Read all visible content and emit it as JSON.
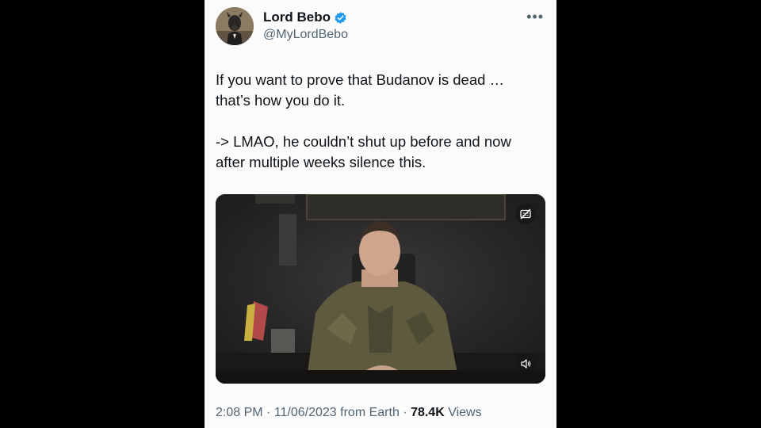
{
  "tweet": {
    "display_name": "Lord Bebo",
    "handle": "@MyLordBebo",
    "more_label": "•••",
    "paragraphs": [
      "If you want to prove that Budanov is dead …\nthat’s how you do it.",
      "-> LMAO, he couldn’t shut up before and now\nafter multiple weeks silence this."
    ],
    "time": "2:08 PM",
    "sep1": " · ",
    "date": "11/06/2023",
    "source": " from Earth",
    "sep2": " · ",
    "views_count": "78.4K",
    "views_label": " Views"
  },
  "icons": {
    "verified": "verified-badge-icon",
    "captions": "captions-icon",
    "volume": "volume-icon",
    "more": "more-options-icon"
  },
  "colors": {
    "verified_blue": "#1d9bf0",
    "text_primary": "#0f1419",
    "text_secondary": "#536471",
    "card_bg": "#fbfbfb"
  }
}
